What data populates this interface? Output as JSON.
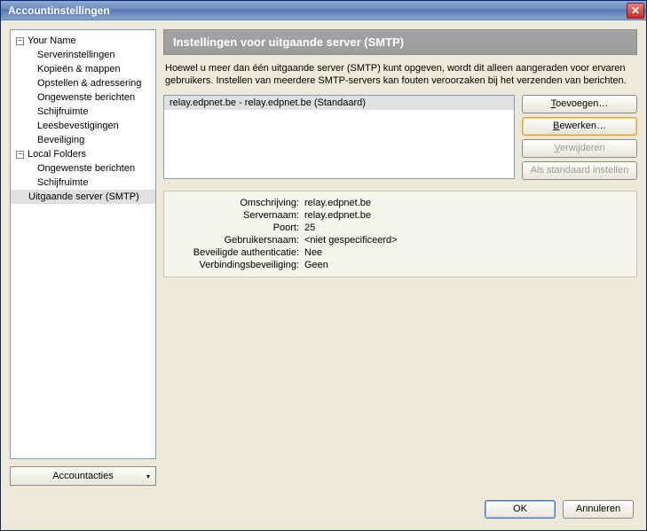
{
  "window": {
    "title": "Accountinstellingen"
  },
  "tree": {
    "accounts": [
      {
        "name": "Your Name",
        "children": [
          "Serverinstellingen",
          "Kopieën & mappen",
          "Opstellen & adressering",
          "Ongewenste berichten",
          "Schijfruimte",
          "Leesbevestigingen",
          "Beveiliging"
        ]
      },
      {
        "name": "Local Folders",
        "children": [
          "Ongewenste berichten",
          "Schijfruimte"
        ]
      }
    ],
    "smtp_item": "Uitgaande server (SMTP)"
  },
  "account_actions_label": "Accountacties",
  "panel": {
    "title": "Instellingen voor uitgaande server (SMTP)",
    "description": "Hoewel u meer dan één uitgaande server (SMTP) kunt opgeven, wordt dit alleen aangeraden voor ervaren gebruikers. Instellen van meerdere SMTP-servers kan fouten veroorzaken bij het verzenden van berichten."
  },
  "servers": [
    {
      "display": "relay.edpnet.be - relay.edpnet.be (Standaard)",
      "description": "relay.edpnet.be",
      "server_name": "relay.edpnet.be",
      "port": "25",
      "username": "<niet gespecificeerd>",
      "secure_auth": "Nee",
      "connection_security": "Geen"
    }
  ],
  "buttons": {
    "add_prefix": "T",
    "add_rest": "oevoegen…",
    "edit_prefix": "B",
    "edit_rest": "ewerken…",
    "remove_prefix": "V",
    "remove_rest": "erwijderen",
    "set_default": "Als standaard instellen",
    "ok": "OK",
    "cancel": "Annuleren"
  },
  "detail_labels": {
    "description": "Omschrijving:",
    "server_name": "Servernaam:",
    "port": "Poort:",
    "username": "Gebruikersnaam:",
    "secure_auth": "Beveiligde authenticatie:",
    "connection_security": "Verbindingsbeveiliging:"
  }
}
